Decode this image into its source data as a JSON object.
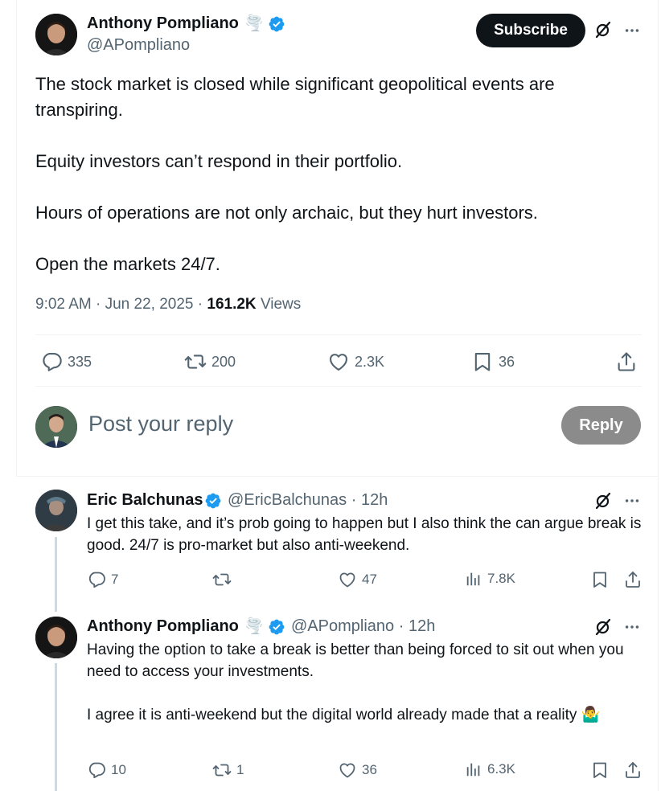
{
  "main_tweet": {
    "author_name": "Anthony Pompliano",
    "author_emoji": "🌪️",
    "author_handle": "@APompliano",
    "subscribe_label": "Subscribe",
    "paragraphs": [
      "The stock market is closed while significant geopolitical events are transpiring.",
      "Equity investors can’t respond in their portfolio.",
      "Hours of operations are not only archaic, but they hurt investors.",
      "Open the markets 24/7."
    ],
    "time": "9:02 AM",
    "date": "Jun 22, 2025",
    "views_count": "161.2K",
    "views_label": "Views",
    "stats": {
      "replies": "335",
      "reposts": "200",
      "likes": "2.3K",
      "bookmarks": "36"
    }
  },
  "reply_composer": {
    "placeholder": "Post your reply",
    "reply_label": "Reply"
  },
  "replies": [
    {
      "author_name": "Eric Balchunas",
      "author_handle": "@EricBalchunas",
      "time_ago": "12h",
      "paragraphs": [
        "I get this take, and it’s prob going to happen but I also think the can argue break is good. 24/7 is pro-market but also anti-weekend."
      ],
      "stats": {
        "replies": "7",
        "reposts": "",
        "likes": "47",
        "views": "7.8K"
      }
    },
    {
      "author_name": "Anthony Pompliano",
      "author_emoji": "🌪️",
      "author_handle": "@APompliano",
      "time_ago": "12h",
      "paragraphs": [
        "Having the option to take a break is better than being forced to sit out when you need to access your investments.",
        "I agree it is anti-weekend but the digital world already made that a reality 🤷‍♂️"
      ],
      "stats": {
        "replies": "10",
        "reposts": "1",
        "likes": "36",
        "views": "6.3K"
      }
    }
  ],
  "separator": "·",
  "colors": {
    "text_primary": "#0f1419",
    "text_secondary": "#536471",
    "verified_badge": "#1d9bf0",
    "subscribe_bg": "#0f1419",
    "reply_button_bg": "#8b8b8b",
    "divider": "#eff3f4",
    "thread_line": "#cfd9de"
  },
  "icons": {
    "verified": "verified-badge-icon",
    "grok": "grok-icon",
    "more": "more-icon",
    "reply": "reply-icon",
    "repost": "repost-icon",
    "like": "like-icon",
    "bookmark": "bookmark-icon",
    "share": "share-icon",
    "views": "views-icon"
  }
}
